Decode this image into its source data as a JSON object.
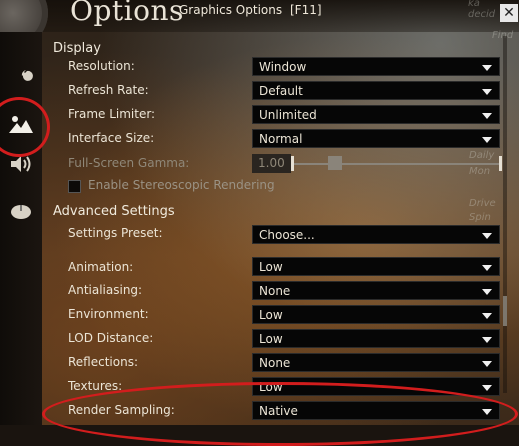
{
  "header": {
    "title": "Options",
    "subtitle": "Graphics Options",
    "hotkey": "[F11]",
    "close_label": "✕"
  },
  "background_text": {
    "top_right": "decid",
    "top_right_small": "Find",
    "right_1": "Daily",
    "right_2": "Mon",
    "right_3": "Drive",
    "right_4": "Spin"
  },
  "sidebar": {
    "items": [
      {
        "icon": "wrench-icon"
      },
      {
        "icon": "mountains-icon",
        "selected": true
      },
      {
        "icon": "speaker-icon"
      },
      {
        "icon": "mouse-icon"
      }
    ]
  },
  "display": {
    "heading": "Display",
    "resolution": {
      "label": "Resolution:",
      "value": "Window"
    },
    "refresh_rate": {
      "label": "Refresh Rate:",
      "value": "Default"
    },
    "frame_limiter": {
      "label": "Frame Limiter:",
      "value": "Unlimited"
    },
    "interface_size": {
      "label": "Interface Size:",
      "value": "Normal"
    },
    "gamma": {
      "label": "Full-Screen Gamma:",
      "value": "1.00",
      "slider_fraction": 0.2
    },
    "stereo": {
      "label": "Enable Stereoscopic Rendering",
      "checked": false
    }
  },
  "advanced": {
    "heading": "Advanced Settings",
    "preset": {
      "label": "Settings Preset:",
      "value": "Choose..."
    },
    "animation": {
      "label": "Animation:",
      "value": "Low"
    },
    "antialiasing": {
      "label": "Antialiasing:",
      "value": "None"
    },
    "environment": {
      "label": "Environment:",
      "value": "Low"
    },
    "lod": {
      "label": "LOD Distance:",
      "value": "Low"
    },
    "reflections": {
      "label": "Reflections:",
      "value": "None"
    },
    "textures": {
      "label": "Textures:",
      "value": "Low"
    },
    "render_sampling": {
      "label": "Render Sampling:",
      "value": "Native"
    }
  },
  "colors": {
    "annotation_red": "#d21d1d",
    "dropdown_bg": "#060606"
  }
}
